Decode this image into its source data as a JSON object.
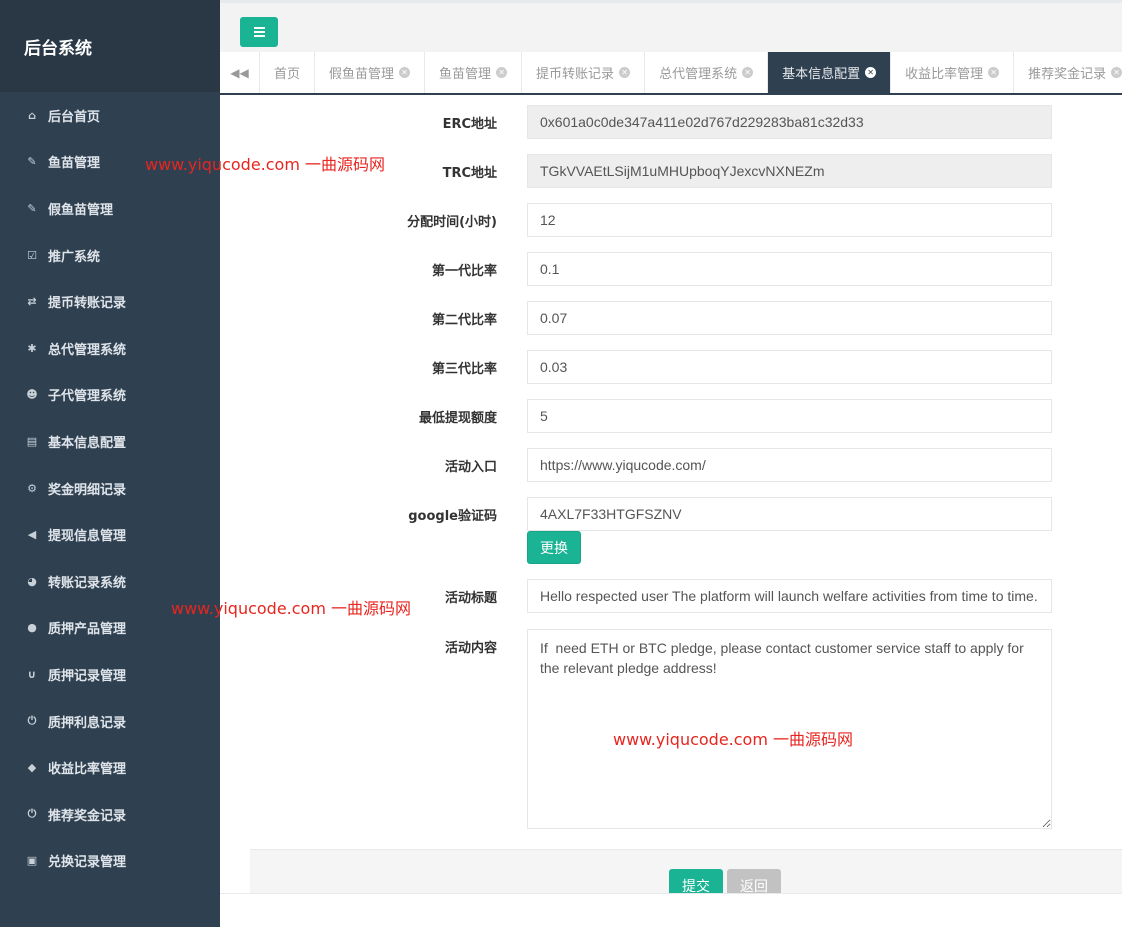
{
  "brand": {
    "title": "后台系统"
  },
  "sidebar": {
    "items": [
      {
        "icon": "home-icon",
        "glyph": "⌂",
        "label": "后台首页"
      },
      {
        "icon": "wrench-icon",
        "glyph": "✎",
        "label": "鱼苗管理"
      },
      {
        "icon": "wrench-icon",
        "glyph": "✎",
        "label": "假鱼苗管理"
      },
      {
        "icon": "edit-icon",
        "glyph": "☑",
        "label": "推广系统"
      },
      {
        "icon": "shuffle-icon",
        "glyph": "⇄",
        "label": "提币转账记录"
      },
      {
        "icon": "asterisk-icon",
        "glyph": "✱",
        "label": "总代管理系统"
      },
      {
        "icon": "users-icon",
        "glyph": "☻",
        "label": "子代管理系统"
      },
      {
        "icon": "file-icon",
        "glyph": "▤",
        "label": "基本信息配置"
      },
      {
        "icon": "cogs-icon",
        "glyph": "⚙",
        "label": "奖金明细记录"
      },
      {
        "icon": "bullhorn-icon",
        "glyph": "◀",
        "label": "提现信息管理"
      },
      {
        "icon": "dashboard-icon",
        "glyph": "◕",
        "label": "转账记录系统"
      },
      {
        "icon": "comment-icon",
        "glyph": "●",
        "label": "质押产品管理"
      },
      {
        "icon": "magnet-icon",
        "glyph": "∪",
        "label": "质押记录管理"
      },
      {
        "icon": "power-icon",
        "glyph": "⏻",
        "label": "质押利息记录"
      },
      {
        "icon": "shield-icon",
        "glyph": "◆",
        "label": "收益比率管理"
      },
      {
        "icon": "power-icon",
        "glyph": "⏻",
        "label": "推荐奖金记录"
      },
      {
        "icon": "save-icon",
        "glyph": "▣",
        "label": "兑换记录管理"
      }
    ]
  },
  "tabs": {
    "back_glyph": "◀◀",
    "close_glyph": "✕",
    "items": [
      {
        "label": "首页",
        "closable": false,
        "active": false
      },
      {
        "label": "假鱼苗管理",
        "closable": true,
        "active": false
      },
      {
        "label": "鱼苗管理",
        "closable": true,
        "active": false
      },
      {
        "label": "提币转账记录",
        "closable": true,
        "active": false
      },
      {
        "label": "总代管理系统",
        "closable": true,
        "active": false
      },
      {
        "label": "基本信息配置",
        "closable": true,
        "active": true
      },
      {
        "label": "收益比率管理",
        "closable": true,
        "active": false
      },
      {
        "label": "推荐奖金记录",
        "closable": true,
        "active": false
      }
    ]
  },
  "form": {
    "erc_label": "ERC地址",
    "erc_value": "0x601a0c0de347a411e02d767d229283ba81c32d33",
    "trc_label": "TRC地址",
    "trc_value": "TGkVVAEtLSijM1uMHUpboqYJexcvNXNEZm",
    "hours_label": "分配时间(小时)",
    "hours_value": "12",
    "gen1_label": "第一代比率",
    "gen1_value": "0.1",
    "gen2_label": "第二代比率",
    "gen2_value": "0.07",
    "gen3_label": "第三代比率",
    "gen3_value": "0.03",
    "min_withdraw_label": "最低提现额度",
    "min_withdraw_value": "5",
    "entry_label": "活动入口",
    "entry_value": "https://www.yiqucode.com/",
    "google_label": "google验证码",
    "google_value": "4AXL7F33HTGFSZNV",
    "change_button": "更换",
    "title_label": "活动标题",
    "title_value": "Hello respected user The platform will launch welfare activities from time to time.",
    "content_label": "活动内容",
    "content_value": "If  need ETH or BTC pledge, please contact customer service staff to apply for the relevant pledge address!",
    "submit_button": "提交",
    "back_button": "返回"
  },
  "watermarks": {
    "text1": "www.yiqucode.com   一曲源码网",
    "text2": "www.yiqucode.com   一曲源码网",
    "text3": "www.yiqucode.com   一曲源码网"
  },
  "colors": {
    "accent": "#1ab394",
    "sidebar": "#2f4050",
    "watermark": "#e8251f"
  }
}
